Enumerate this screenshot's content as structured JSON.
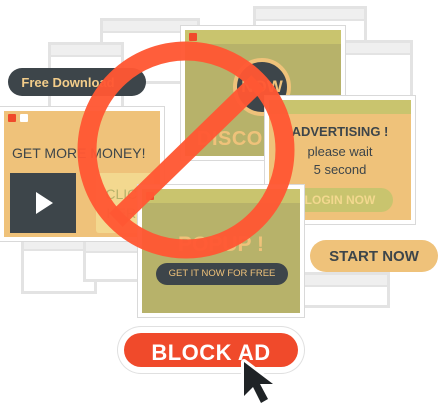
{
  "colors": {
    "olive": "#b7b26a",
    "olive_dark": "#9f9a55",
    "tan": "#efc27a",
    "tan_light": "#f3cd8a",
    "red": "#f04a2b",
    "dark": "#3d454a",
    "white": "#ffffff"
  },
  "free_download": {
    "label": "Free Download"
  },
  "money_popup": {
    "headline": "GET MORE MONEY!",
    "click_label": "CLICK HERE",
    "play_icon": "play-icon"
  },
  "discount_popup": {
    "now_badge": "NOW",
    "label": "DISCOUNT"
  },
  "advert_popup": {
    "title": "ADVERTISING !",
    "line1": "please wait",
    "line2": "5 second",
    "login_label": "LOGIN NOW"
  },
  "popup_window": {
    "title": "POPUP !",
    "cta": "GET IT NOW FOR FREE"
  },
  "start_now": {
    "label": "START NOW"
  },
  "block_ad": {
    "label": "BLOCK AD",
    "cursor_icon": "cursor-arrow-icon"
  },
  "no_sign_icon": "prohibition-icon"
}
